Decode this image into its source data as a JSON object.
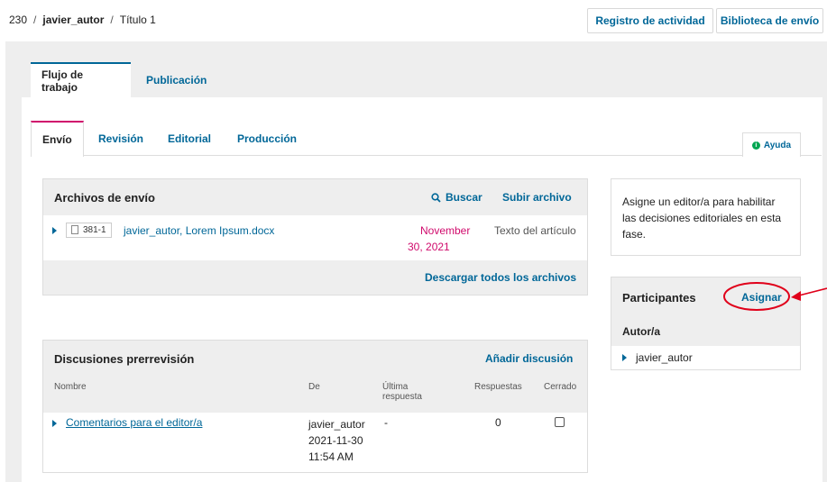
{
  "breadcrumb": {
    "id": "230",
    "author": "javier_autor",
    "title": "Título 1"
  },
  "header_buttons": {
    "activity_log": "Registro de actividad",
    "library": "Biblioteca de envío"
  },
  "main_tabs": [
    {
      "label": "Flujo de trabajo",
      "active": true
    },
    {
      "label": "Publicación",
      "active": false
    }
  ],
  "sub_tabs": [
    {
      "label": "Envío",
      "active": true
    },
    {
      "label": "Revisión",
      "active": false
    },
    {
      "label": "Editorial",
      "active": false
    },
    {
      "label": "Producción",
      "active": false
    }
  ],
  "help": {
    "label": "Ayuda",
    "icon": "info-icon"
  },
  "files_grid": {
    "title": "Archivos de envío",
    "search_label": "Buscar",
    "upload_label": "Subir archivo",
    "rows": [
      {
        "id": "381-1",
        "name": "javier_autor, Lorem Ipsum.docx",
        "date_line1": "November",
        "date_line2": "30, 2021",
        "type": "Texto del artículo"
      }
    ],
    "download_all": "Descargar todos los archivos"
  },
  "discussions_grid": {
    "title": "Discusiones prerrevisión",
    "add_label": "Añadir discusión",
    "columns": {
      "name": "Nombre",
      "from": "De",
      "last_reply_1": "Última",
      "last_reply_2": "respuesta",
      "replies": "Respuestas",
      "closed": "Cerrado"
    },
    "rows": [
      {
        "name": "Comentarios para el editor/a",
        "from_user": "javier_autor",
        "from_date": "2021-11-30",
        "from_time": "11:54 AM",
        "last_reply": "-",
        "replies": "0"
      }
    ]
  },
  "assign_note": "Asigne un editor/a para habilitar las decisiones editoriales en esta fase.",
  "participants": {
    "title": "Participantes",
    "assign_label": "Asignar",
    "group": "Autor/a",
    "members": [
      "javier_autor"
    ]
  },
  "colors": {
    "link": "#006798",
    "active_subtab": "#d00a6c",
    "annotation": "#e0001a",
    "date": "#d00a6c"
  }
}
